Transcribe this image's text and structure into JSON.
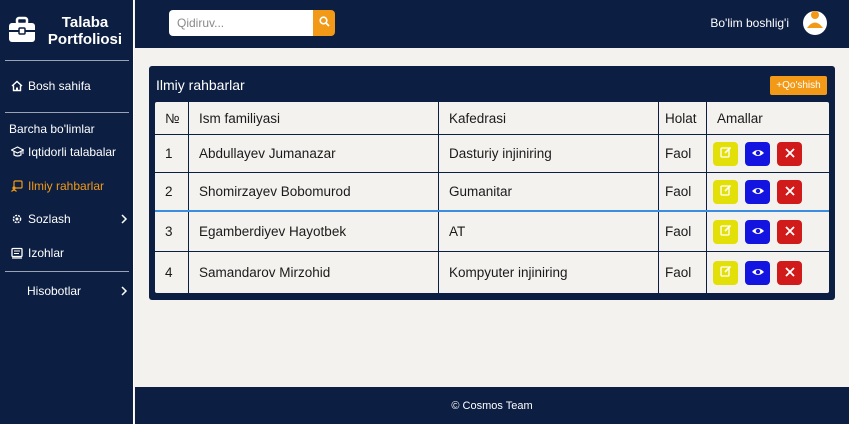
{
  "app": {
    "brand_line1": "Talaba",
    "brand_line2": "Portfoliosi"
  },
  "search": {
    "placeholder": "Qidiruv..."
  },
  "header": {
    "user_label": "Bo'lim boshlig'i"
  },
  "sidebar": {
    "home": "Bosh sahifa",
    "section_label": "Barcha bo'limlar",
    "items": [
      {
        "label": "Iqtidorli talabalar"
      },
      {
        "label": "Ilmiy rahbarlar"
      },
      {
        "label": "Sozlash"
      },
      {
        "label": "Izohlar"
      },
      {
        "label": "Hisobotlar"
      }
    ]
  },
  "panel": {
    "title": "Ilmiy rahbarlar",
    "add_label": "+Qo'shish",
    "columns": [
      "№",
      "Ism familiyasi",
      "Kafedrasi",
      "Holat",
      "Amallar"
    ],
    "rows": [
      {
        "num": "1",
        "name": "Abdullayev Jumanazar",
        "dept": "Dasturiy injiniring",
        "status": "Faol"
      },
      {
        "num": "2",
        "name": "Shomirzayev Bobomurod",
        "dept": "Gumanitar",
        "status": "Faol"
      },
      {
        "num": "3",
        "name": "Egamberdiyev Hayotbek",
        "dept": "AT",
        "status": "Faol"
      },
      {
        "num": "4",
        "name": "Samandarov Mirzohid",
        "dept": "Kompyuter injiniring",
        "status": "Faol"
      }
    ]
  },
  "footer": {
    "text": "© Cosmos Team"
  },
  "colors": {
    "navy": "#0c1e42",
    "accent": "#f29a17",
    "edit": "#e3e009",
    "view": "#1414e0",
    "delete": "#d11a1a"
  }
}
